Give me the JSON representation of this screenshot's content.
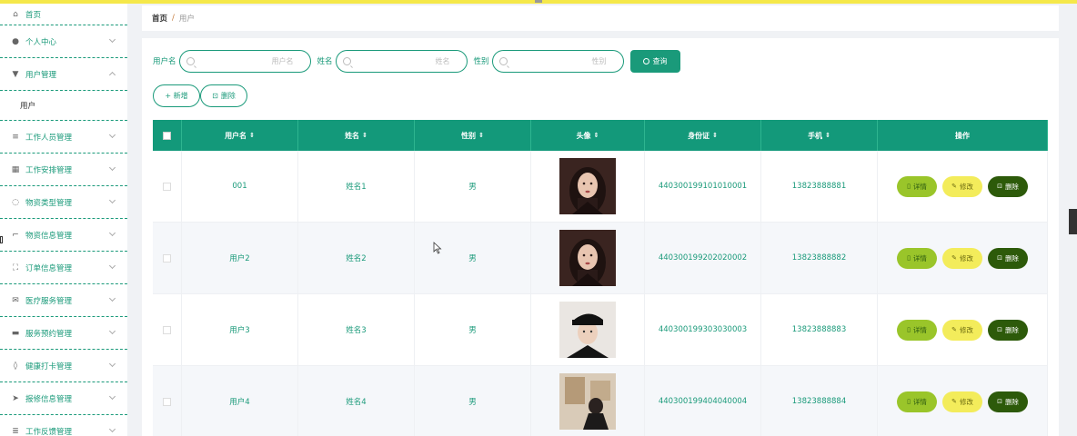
{
  "breadcrumb": {
    "home": "首页",
    "separator": "/",
    "current": "用户"
  },
  "sidebar": {
    "items": [
      {
        "label": "首页",
        "icon": "home-icon",
        "glyph": "⌂"
      },
      {
        "label": "个人中心",
        "icon": "user-icon",
        "glyph": "●"
      },
      {
        "label": "用户管理",
        "icon": "user-manage-icon",
        "glyph": "▼",
        "expanded": true
      },
      {
        "label": "用户",
        "sub": true
      },
      {
        "label": "工作人员管理",
        "icon": "list-icon",
        "glyph": "≡"
      },
      {
        "label": "工作安排管理",
        "icon": "grid-icon",
        "glyph": "▦"
      },
      {
        "label": "物资类型管理",
        "icon": "power-icon",
        "glyph": "◌"
      },
      {
        "label": "物资信息管理",
        "icon": "crop-icon",
        "glyph": "⌐"
      },
      {
        "label": "订单信息管理",
        "icon": "fullscreen-icon",
        "glyph": "⛶"
      },
      {
        "label": "医疗服务管理",
        "icon": "mail-icon",
        "glyph": "✉"
      },
      {
        "label": "服务预约管理",
        "icon": "printer-icon",
        "glyph": "▬"
      },
      {
        "label": "健康打卡管理",
        "icon": "bulb-icon",
        "glyph": "◊"
      },
      {
        "label": "报修信息管理",
        "icon": "send-icon",
        "glyph": "➤"
      },
      {
        "label": "工作反馈管理",
        "icon": "sliders-icon",
        "glyph": "≣"
      }
    ]
  },
  "search": {
    "username_label": "用户名",
    "username_placeholder": "用户名",
    "name_label": "姓名",
    "name_placeholder": "姓名",
    "gender_label": "性别",
    "gender_placeholder": "性别",
    "query_button": "查询"
  },
  "actions": {
    "add": "+ 新增",
    "delete": "删除"
  },
  "table": {
    "headers": [
      "用户名",
      "姓名",
      "性别",
      "头像",
      "身份证",
      "手机",
      "操作"
    ],
    "rows": [
      {
        "username": "001",
        "name": "姓名1",
        "gender": "男",
        "id_card": "440300199101010001",
        "phone": "13823888881"
      },
      {
        "username": "用户2",
        "name": "姓名2",
        "gender": "男",
        "id_card": "440300199202020002",
        "phone": "13823888882"
      },
      {
        "username": "用户3",
        "name": "姓名3",
        "gender": "男",
        "id_card": "440300199303030003",
        "phone": "13823888883"
      },
      {
        "username": "用户4",
        "name": "姓名4",
        "gender": "男",
        "id_card": "440300199404040004",
        "phone": "13823888884"
      }
    ],
    "row_actions": {
      "detail": "详情",
      "edit": "修改",
      "delete": "删除"
    }
  },
  "colors": {
    "primary": "#13997a",
    "detail": "#9ac52a",
    "edit": "#f3ec5b",
    "delete": "#2d5a0a"
  }
}
